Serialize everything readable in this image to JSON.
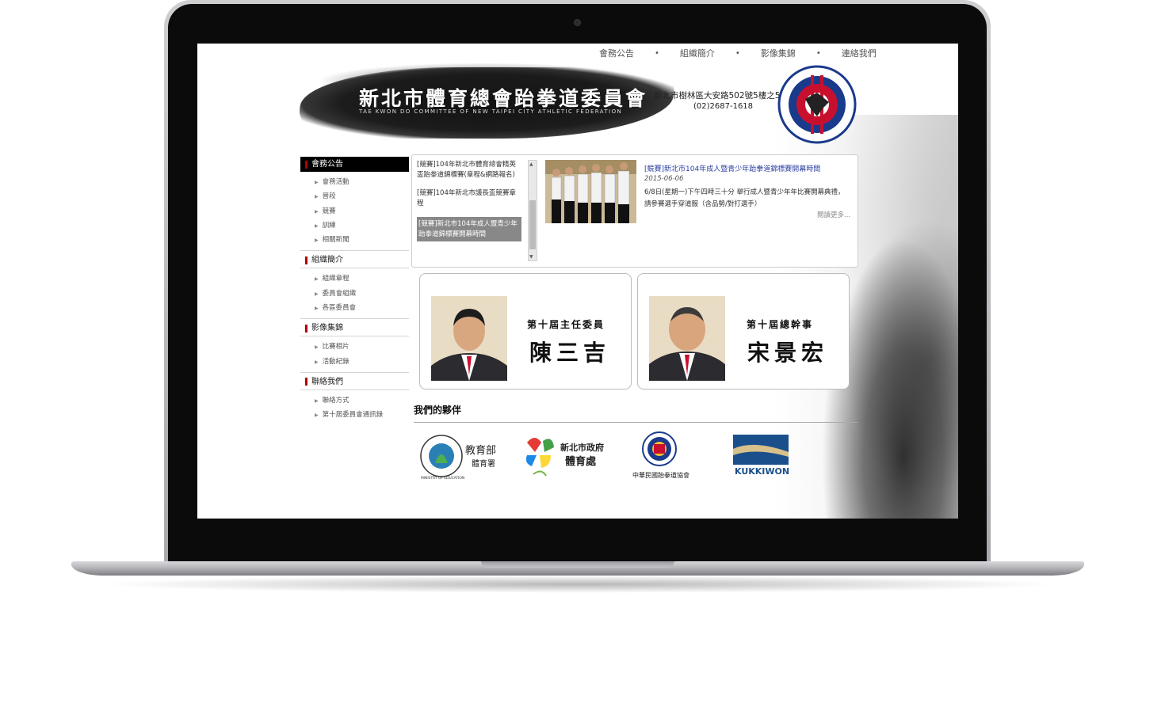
{
  "site": {
    "title": "新北市體育總會跆拳道委員會",
    "subtitle": "TAE KWON DO COMMITTEE OF NEW TAIPEI CITY ATHLETIC FEDERATION",
    "address": "新北市樹林區大安路502號5樓之5",
    "phone": "(02)2687-1618"
  },
  "top_nav": {
    "items": [
      "會務公告",
      "組織簡介",
      "影像集錦",
      "連絡我們"
    ],
    "separator": "•"
  },
  "sidebar": {
    "sections": [
      {
        "label": "會務公告",
        "items": [
          "會務活動",
          "晉段",
          "競賽",
          "訓練",
          "相關新聞"
        ]
      },
      {
        "label": "組織簡介",
        "items": [
          "組織章程",
          "委員會組織",
          "各區委員會"
        ]
      },
      {
        "label": "影像集錦",
        "items": [
          "比賽相片",
          "活動紀錄"
        ]
      },
      {
        "label": "聯絡我們",
        "items": [
          "聯絡方式",
          "第十屆委員會通訊錄"
        ]
      }
    ]
  },
  "news": {
    "list": [
      "[競賽]104年新北市體育總會精英盃跆拳道錦標賽(章程&網路報名)",
      "[競賽]104年新北市議長盃競賽章程",
      "[競賽]新北市104年成人暨青少年跆拳道錦標賽開幕時間"
    ],
    "featured_title": "[競賽]新北市104年成人暨青少年跆拳道錦標賽開幕時間",
    "featured_date": "2015-06-06",
    "featured_body": "6/8日(星期一)下午四時三十分 舉行成人暨青少年年比賽開幕典禮，請參賽選手穿道服（含品勢/對打選手）",
    "more_label": "閱讀更多..."
  },
  "people": [
    {
      "role": "第十屆主任委員",
      "name": "陳三吉"
    },
    {
      "role": "第十屆總幹事",
      "name": "宋景宏"
    }
  ],
  "partners": {
    "title": "我們的夥伴",
    "moe_main": "教育部",
    "moe_sub": "體育署",
    "moe_ring": "MINISTRY OF EDUCATION",
    "ntpc_main": "新北市政府",
    "ntpc_sub": "體育處",
    "ctf_name": "中華民國跆拳道協會",
    "kukkiwon": "KUKKIWON"
  },
  "colors": {
    "accent_red": "#b40000",
    "link_blue": "#2a3fa0",
    "active_black": "#000000"
  }
}
